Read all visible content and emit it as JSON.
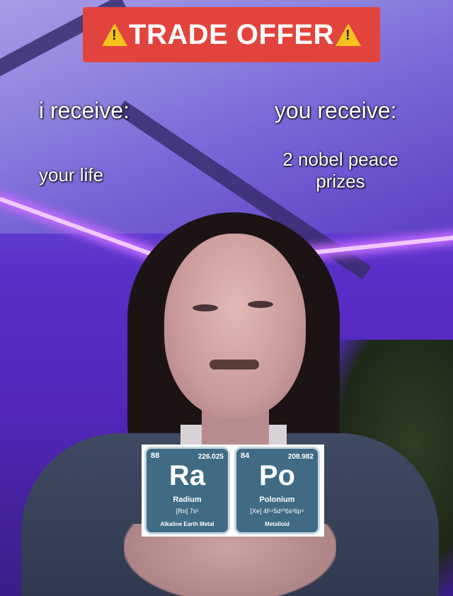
{
  "banner": {
    "text": "TRADE OFFER",
    "warning_glyph": "!"
  },
  "left": {
    "header": "i receive:",
    "item": "your life"
  },
  "right": {
    "header": "you receive:",
    "item_line1": "2 nobel peace",
    "item_line2": "prizes"
  },
  "elements": [
    {
      "number": "88",
      "mass": "226.025",
      "symbol": "Ra",
      "name": "Radium",
      "config": "[Rn] 7s²",
      "category": "Alkaline Earth Metal"
    },
    {
      "number": "84",
      "mass": "208.982",
      "symbol": "Po",
      "name": "Polonium",
      "config": "[Xe] 4f¹⁴5d¹⁰6s²6p⁴",
      "category": "Metalloid"
    }
  ],
  "colors": {
    "banner": "#e2443d",
    "warning": "#f6c21b",
    "tile": "#3f6b85"
  }
}
